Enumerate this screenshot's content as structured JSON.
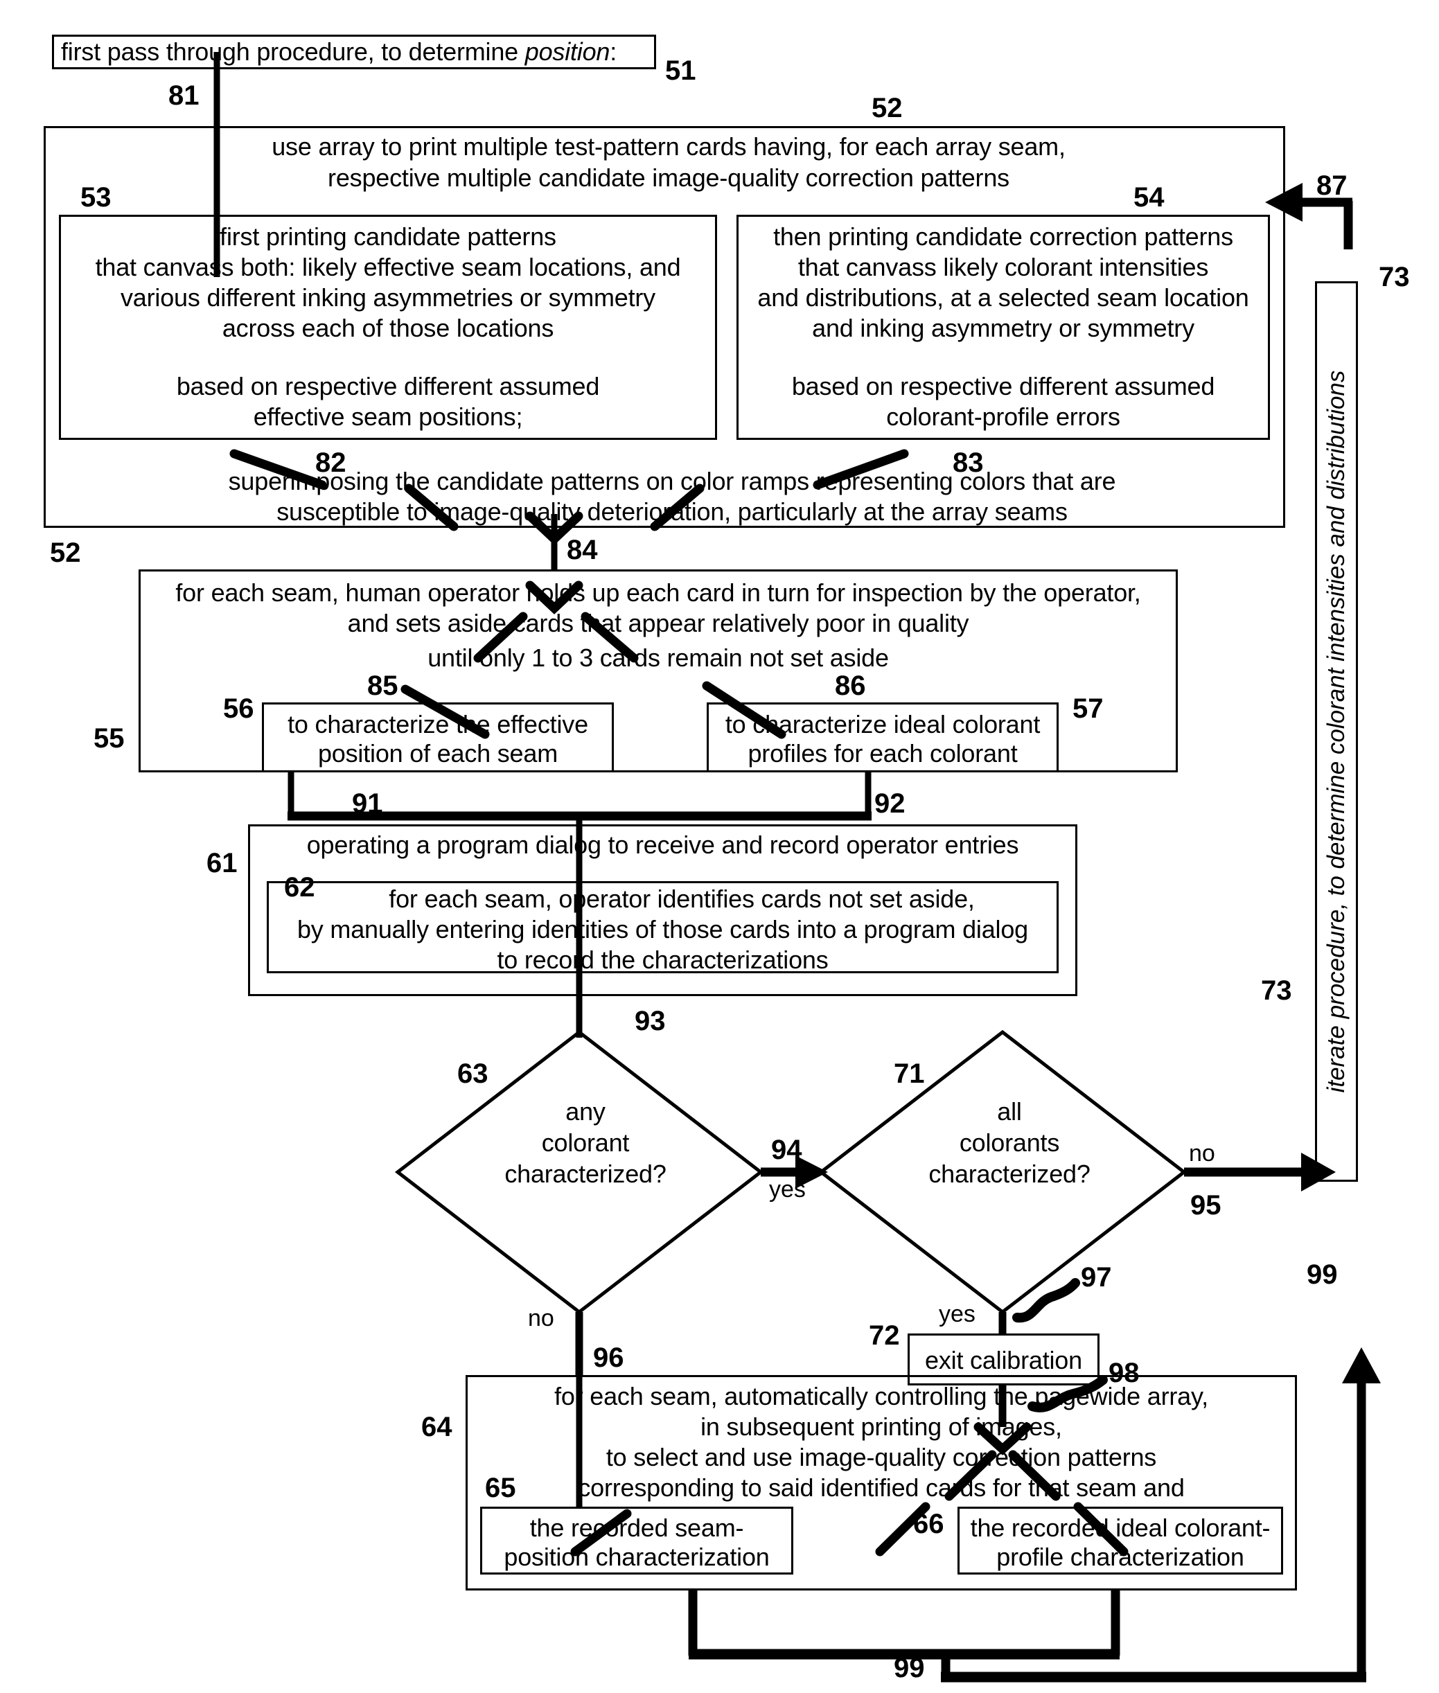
{
  "figure": {
    "title_box": {
      "id": "51",
      "text_plain": "first pass through procedure, to determine ",
      "text_italic": "position",
      "text_tail": ":"
    },
    "nodes": {
      "n52": {
        "id": "52",
        "id_repeat": "52",
        "line1": "use array to print multiple test-pattern cards having, for each array seam,",
        "line2": "respective multiple candidate image-quality correction patterns",
        "footer_line1": "superimposing the candidate patterns on color ramps representing colors that are",
        "footer_line2": "susceptible to image-quality deterioration, particularly at the array seams"
      },
      "n53": {
        "id": "53",
        "line1": "first printing candidate patterns",
        "line2": "that canvass both:  likely effective seam locations, and",
        "line3": "various different inking asymmetries or symmetry",
        "line4": "across each of  those locations",
        "line5": "based on respective different assumed",
        "line6": "effective seam positions;"
      },
      "n54": {
        "id": "54",
        "line1": "then printing candidate correction patterns",
        "line2": "that  canvass likely colorant intensities",
        "line3": "and distributions, at a selected seam location",
        "line4": "and inking asymmetry or symmetry",
        "line5": "based on respective different assumed",
        "line6": "colorant-profile errors"
      },
      "n55": {
        "id": "55",
        "line1": "for each seam, human operator holds up each card in turn for inspection by the operator,",
        "line2": "and sets aside cards that appear relatively poor in quality",
        "line3": "until only 1 to 3 cards remain not set aside"
      },
      "n56": {
        "id": "56",
        "line1": "to characterize the effective",
        "line2": "position of each seam"
      },
      "n57": {
        "id": "57",
        "line1": "to characterize ideal colorant",
        "line2": "profiles for each colorant"
      },
      "n61": {
        "id": "61",
        "line1": "operating a program dialog to receive and record operator entries"
      },
      "n62": {
        "id": "62",
        "line1": "for each seam, operator identifies cards not set aside,",
        "line2": "by manually entering identities of those cards into a program dialog",
        "line3": "to record the characterizations"
      },
      "n63": {
        "id": "63",
        "line1": "any",
        "line2": "colorant",
        "line3": "characterized?"
      },
      "n71": {
        "id": "71",
        "line1": "all",
        "line2": "colorants",
        "line3": "characterized?"
      },
      "n72": {
        "id": "72",
        "line1": "exit calibration"
      },
      "n73": {
        "id": "73",
        "id_lower": "73",
        "text_plain": "iterate procedure, to determine ",
        "text_italic": "colorant intensities and distributions"
      },
      "n64": {
        "id": "64",
        "line1": "for each seam, automatically controlling the pagewide array,",
        "line2": "in subsequent printing of images,",
        "line3": "to select and use image-quality correction patterns",
        "line4": "corresponding to said identified cards for that seam and"
      },
      "n65": {
        "id": "65",
        "line1": "the recorded seam-",
        "line2": "position characterization"
      },
      "n66": {
        "id": "66",
        "line1": "the recorded ideal colorant-",
        "line2": "profile characterization"
      }
    },
    "edges": {
      "e81": "81",
      "e82": "82",
      "e83": "83",
      "e84": "84",
      "e85": "85",
      "e86": "86",
      "e87": "87",
      "e91": "91",
      "e92": "92",
      "e93": "93",
      "e94": "94",
      "e95": "95",
      "e96": "96",
      "e97": "97",
      "e98": "98",
      "e99_mid": "99",
      "e99_bottom": "99"
    },
    "edge_labels": {
      "yes_63": "yes",
      "no_63": "no",
      "no_71": "no",
      "yes_71": "yes"
    },
    "colors": {
      "ink": "#000000",
      "paper": "#ffffff"
    }
  }
}
